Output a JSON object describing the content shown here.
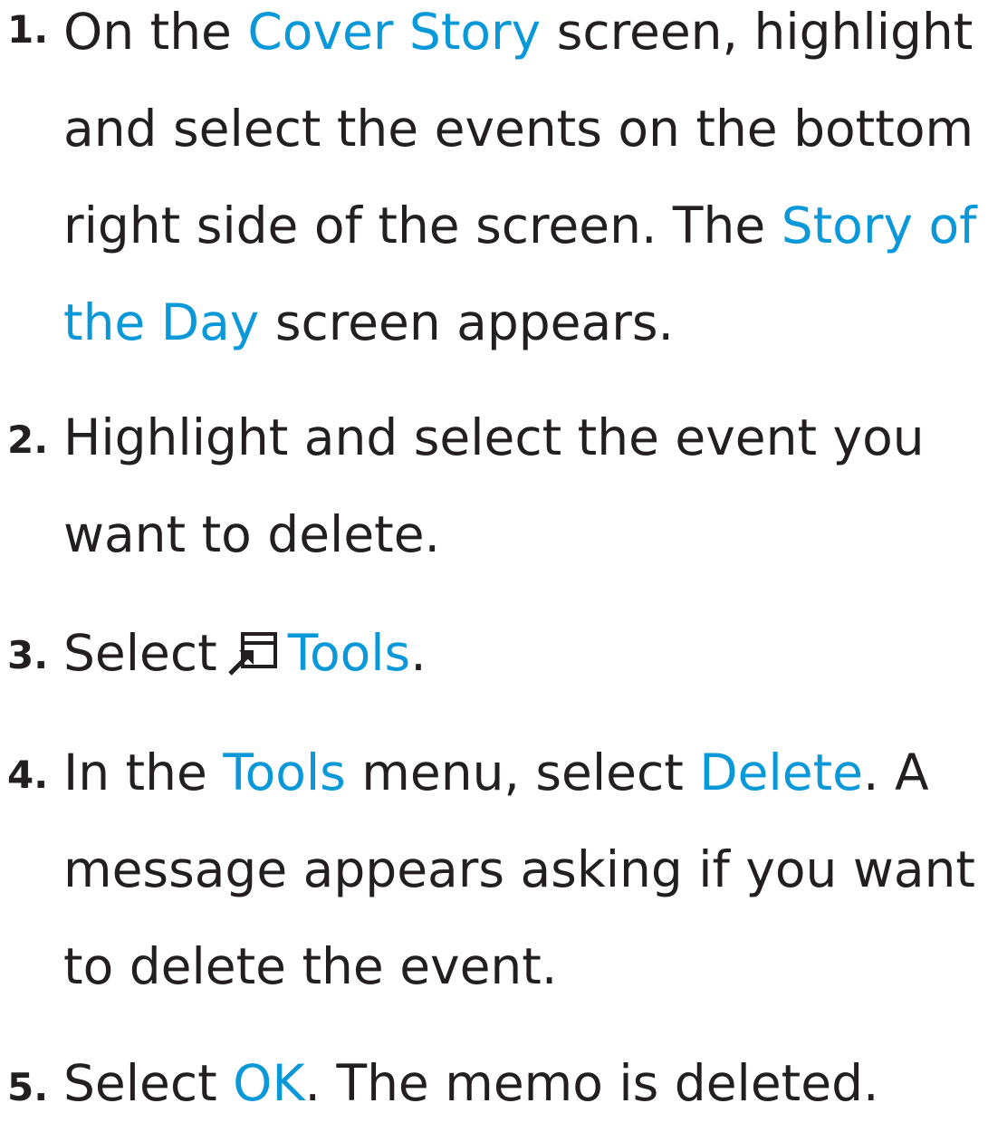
{
  "steps": [
    {
      "number": "1.",
      "parts": {
        "a": "On the ",
        "b": "Cover Story",
        "c": " screen, highlight and select the events on the bottom right side of the screen. The ",
        "d": "Story of the Day",
        "e": " screen appears."
      }
    },
    {
      "number": "2.",
      "parts": {
        "a": "Highlight and select the event you want to delete."
      }
    },
    {
      "number": "3.",
      "parts": {
        "a": "Select",
        "icon": "tools-remote-icon",
        "b": "Tools",
        "c": "."
      }
    },
    {
      "number": "4.",
      "parts": {
        "a": "In the ",
        "b": "Tools",
        "c": " menu, select ",
        "d": "Delete",
        "e": ". A message appears asking if you want to delete the event."
      }
    },
    {
      "number": "5.",
      "parts": {
        "a": "Select ",
        "b": "OK",
        "c": ". The memo is deleted."
      }
    }
  ],
  "colors": {
    "text": "#231f20",
    "highlight": "#0a98d8"
  }
}
